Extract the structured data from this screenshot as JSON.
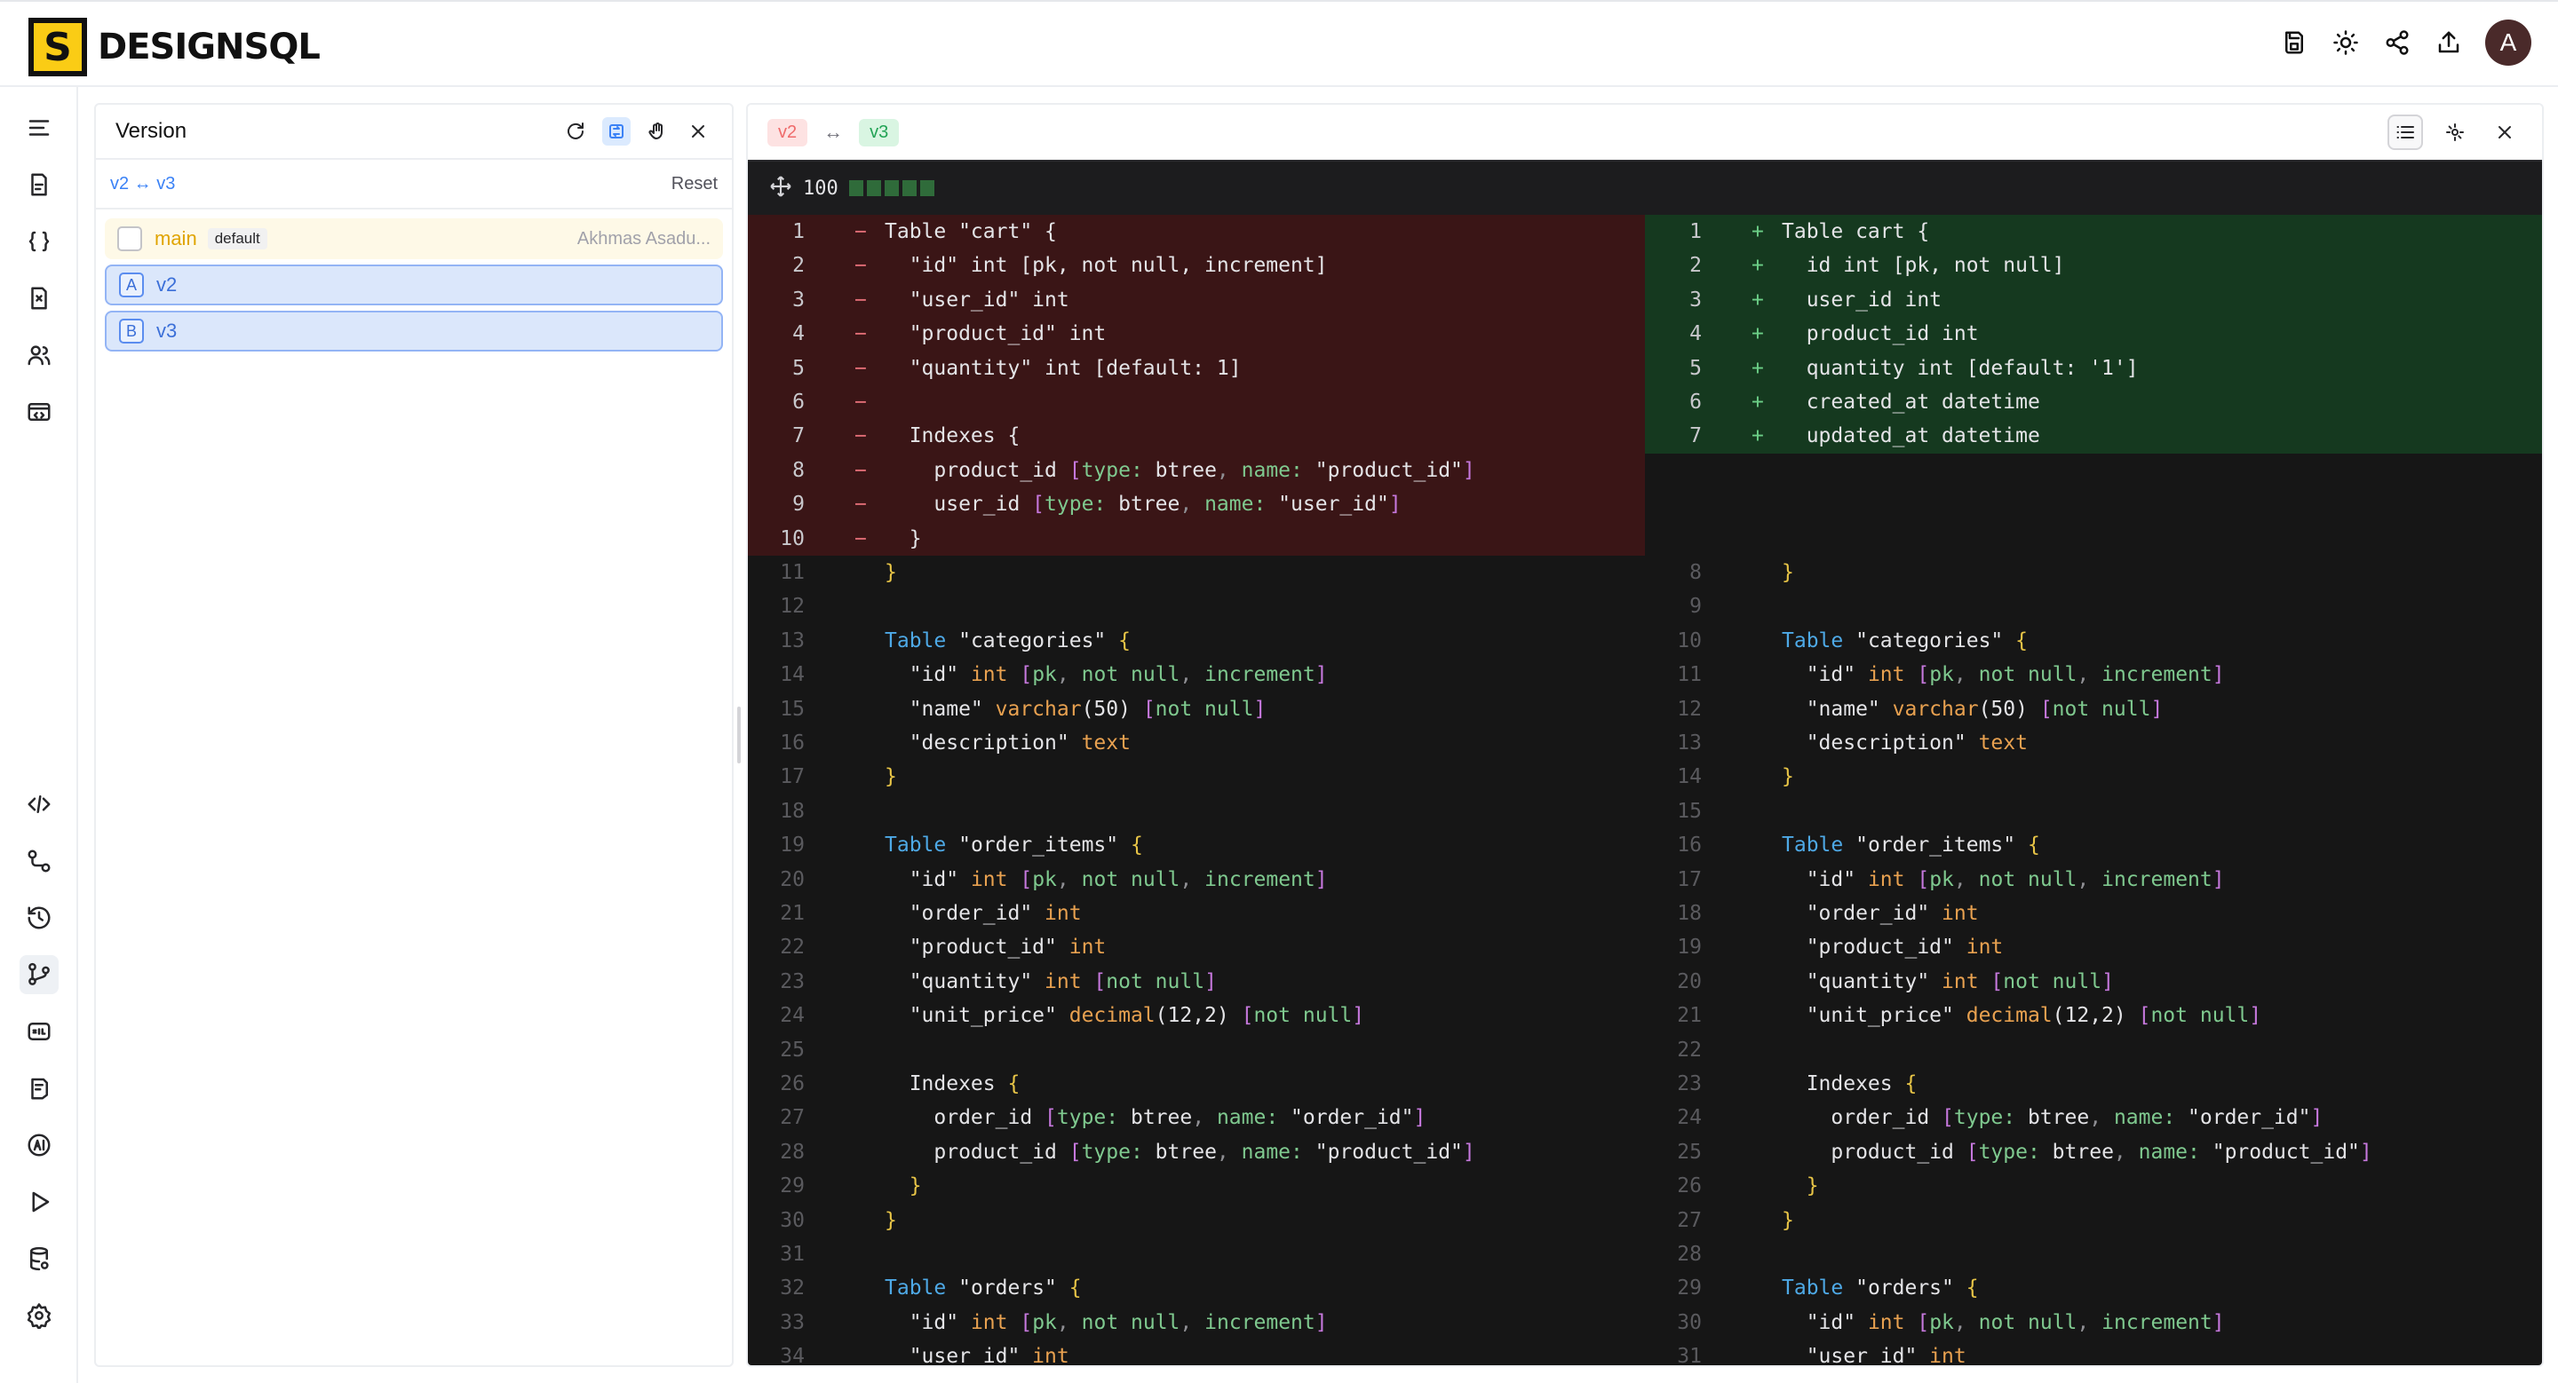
{
  "app": {
    "logo_letter": "S",
    "logo_text": "DESIGNSQL",
    "avatar_letter": "A",
    "top_icons": [
      "save-icon",
      "theme-sun-icon",
      "share-icon",
      "export-icon"
    ]
  },
  "rail": {
    "top_icons": [
      "menu-icon",
      "schema-icon",
      "braces-icon",
      "diagram-icon",
      "users-icon",
      "api-icon"
    ],
    "bottom_icons": [
      "code-icon",
      "relations-icon",
      "history-icon",
      "version-icon",
      "sql-icon",
      "notes-icon",
      "ai-icon",
      "play-icon",
      "database-icon",
      "settings-icon"
    ]
  },
  "version_panel": {
    "title": "Version",
    "compare_label": "v2 ↔ v3",
    "reset_label": "Reset",
    "versions": [
      {
        "name": "main",
        "badge": "default",
        "author": "Akhmas Asadu...",
        "kind": "main"
      },
      {
        "name": "v2",
        "letter": "A",
        "kind": "selected"
      },
      {
        "name": "v3",
        "letter": "B",
        "kind": "selected"
      }
    ]
  },
  "diff_panel": {
    "from_tag": "v2",
    "arrow": "↔",
    "to_tag": "v3",
    "zoom": "100",
    "colors": {
      "deleted_bg": "#3a1516",
      "added_bg": "#15391f",
      "keyword": "#4ea9e6",
      "type": "#e8a150"
    }
  },
  "diff": {
    "left": [
      {
        "n": "1",
        "mark": "−",
        "text": "Table \"cart\" {",
        "kind": "del"
      },
      {
        "n": "2",
        "mark": "−",
        "text": "  \"id\" int [pk, not null, increment]",
        "kind": "del"
      },
      {
        "n": "3",
        "mark": "−",
        "text": "  \"user_id\" int",
        "kind": "del"
      },
      {
        "n": "4",
        "mark": "−",
        "text": "  \"product_id\" int",
        "kind": "del"
      },
      {
        "n": "5",
        "mark": "−",
        "text": "  \"quantity\" int [default: 1]",
        "kind": "del"
      },
      {
        "n": "6",
        "mark": "−",
        "text": "",
        "kind": "del"
      },
      {
        "n": "7",
        "mark": "−",
        "text": "  Indexes {",
        "kind": "del"
      },
      {
        "n": "8",
        "mark": "−",
        "text": "    product_id [type: btree, name: \"product_id\"]",
        "kind": "del"
      },
      {
        "n": "9",
        "mark": "−",
        "text": "    user_id [type: btree, name: \"user_id\"]",
        "kind": "del"
      },
      {
        "n": "10",
        "mark": "−",
        "text": "  }",
        "kind": "del"
      },
      {
        "n": "11",
        "mark": "",
        "text": "}",
        "kind": "ctx"
      },
      {
        "n": "12",
        "mark": "",
        "text": "",
        "kind": "ctx"
      },
      {
        "n": "13",
        "mark": "",
        "text": "Table \"categories\" {",
        "kind": "ctx"
      },
      {
        "n": "14",
        "mark": "",
        "text": "  \"id\" int [pk, not null, increment]",
        "kind": "ctx"
      },
      {
        "n": "15",
        "mark": "",
        "text": "  \"name\" varchar(50) [not null]",
        "kind": "ctx"
      },
      {
        "n": "16",
        "mark": "",
        "text": "  \"description\" text",
        "kind": "ctx"
      },
      {
        "n": "17",
        "mark": "",
        "text": "}",
        "kind": "ctx"
      },
      {
        "n": "18",
        "mark": "",
        "text": "",
        "kind": "ctx"
      },
      {
        "n": "19",
        "mark": "",
        "text": "Table \"order_items\" {",
        "kind": "ctx"
      },
      {
        "n": "20",
        "mark": "",
        "text": "  \"id\" int [pk, not null, increment]",
        "kind": "ctx"
      },
      {
        "n": "21",
        "mark": "",
        "text": "  \"order_id\" int",
        "kind": "ctx"
      },
      {
        "n": "22",
        "mark": "",
        "text": "  \"product_id\" int",
        "kind": "ctx"
      },
      {
        "n": "23",
        "mark": "",
        "text": "  \"quantity\" int [not null]",
        "kind": "ctx"
      },
      {
        "n": "24",
        "mark": "",
        "text": "  \"unit_price\" decimal(12,2) [not null]",
        "kind": "ctx"
      },
      {
        "n": "25",
        "mark": "",
        "text": "",
        "kind": "ctx"
      },
      {
        "n": "26",
        "mark": "",
        "text": "  Indexes {",
        "kind": "ctx"
      },
      {
        "n": "27",
        "mark": "",
        "text": "    order_id [type: btree, name: \"order_id\"]",
        "kind": "ctx"
      },
      {
        "n": "28",
        "mark": "",
        "text": "    product_id [type: btree, name: \"product_id\"]",
        "kind": "ctx"
      },
      {
        "n": "29",
        "mark": "",
        "text": "  }",
        "kind": "ctx"
      },
      {
        "n": "30",
        "mark": "",
        "text": "}",
        "kind": "ctx"
      },
      {
        "n": "31",
        "mark": "",
        "text": "",
        "kind": "ctx"
      },
      {
        "n": "32",
        "mark": "",
        "text": "Table \"orders\" {",
        "kind": "ctx"
      },
      {
        "n": "33",
        "mark": "",
        "text": "  \"id\" int [pk, not null, increment]",
        "kind": "ctx"
      },
      {
        "n": "34",
        "mark": "",
        "text": "  \"user_id\" int",
        "kind": "ctx"
      }
    ],
    "right": [
      {
        "n": "1",
        "mark": "+",
        "text": "Table cart {",
        "kind": "add"
      },
      {
        "n": "2",
        "mark": "+",
        "text": "  id int [pk, not null]",
        "kind": "add"
      },
      {
        "n": "3",
        "mark": "+",
        "text": "  user_id int",
        "kind": "add"
      },
      {
        "n": "4",
        "mark": "+",
        "text": "  product_id int",
        "kind": "add"
      },
      {
        "n": "5",
        "mark": "+",
        "text": "  quantity int [default: '1']",
        "kind": "add"
      },
      {
        "n": "6",
        "mark": "+",
        "text": "  created_at datetime",
        "kind": "add"
      },
      {
        "n": "7",
        "mark": "+",
        "text": "  updated_at datetime",
        "kind": "add"
      },
      {
        "n": "",
        "mark": "",
        "text": "",
        "kind": "pad"
      },
      {
        "n": "",
        "mark": "",
        "text": "",
        "kind": "pad"
      },
      {
        "n": "",
        "mark": "",
        "text": "",
        "kind": "pad"
      },
      {
        "n": "8",
        "mark": "",
        "text": "}",
        "kind": "ctx"
      },
      {
        "n": "9",
        "mark": "",
        "text": "",
        "kind": "ctx"
      },
      {
        "n": "10",
        "mark": "",
        "text": "Table \"categories\" {",
        "kind": "ctx"
      },
      {
        "n": "11",
        "mark": "",
        "text": "  \"id\" int [pk, not null, increment]",
        "kind": "ctx"
      },
      {
        "n": "12",
        "mark": "",
        "text": "  \"name\" varchar(50) [not null]",
        "kind": "ctx"
      },
      {
        "n": "13",
        "mark": "",
        "text": "  \"description\" text",
        "kind": "ctx"
      },
      {
        "n": "14",
        "mark": "",
        "text": "}",
        "kind": "ctx"
      },
      {
        "n": "15",
        "mark": "",
        "text": "",
        "kind": "ctx"
      },
      {
        "n": "16",
        "mark": "",
        "text": "Table \"order_items\" {",
        "kind": "ctx"
      },
      {
        "n": "17",
        "mark": "",
        "text": "  \"id\" int [pk, not null, increment]",
        "kind": "ctx"
      },
      {
        "n": "18",
        "mark": "",
        "text": "  \"order_id\" int",
        "kind": "ctx"
      },
      {
        "n": "19",
        "mark": "",
        "text": "  \"product_id\" int",
        "kind": "ctx"
      },
      {
        "n": "20",
        "mark": "",
        "text": "  \"quantity\" int [not null]",
        "kind": "ctx"
      },
      {
        "n": "21",
        "mark": "",
        "text": "  \"unit_price\" decimal(12,2) [not null]",
        "kind": "ctx"
      },
      {
        "n": "22",
        "mark": "",
        "text": "",
        "kind": "ctx"
      },
      {
        "n": "23",
        "mark": "",
        "text": "  Indexes {",
        "kind": "ctx"
      },
      {
        "n": "24",
        "mark": "",
        "text": "    order_id [type: btree, name: \"order_id\"]",
        "kind": "ctx"
      },
      {
        "n": "25",
        "mark": "",
        "text": "    product_id [type: btree, name: \"product_id\"]",
        "kind": "ctx"
      },
      {
        "n": "26",
        "mark": "",
        "text": "  }",
        "kind": "ctx"
      },
      {
        "n": "27",
        "mark": "",
        "text": "}",
        "kind": "ctx"
      },
      {
        "n": "28",
        "mark": "",
        "text": "",
        "kind": "ctx"
      },
      {
        "n": "29",
        "mark": "",
        "text": "Table \"orders\" {",
        "kind": "ctx"
      },
      {
        "n": "30",
        "mark": "",
        "text": "  \"id\" int [pk, not null, increment]",
        "kind": "ctx"
      },
      {
        "n": "31",
        "mark": "",
        "text": "  \"user_id\" int",
        "kind": "ctx"
      }
    ]
  }
}
